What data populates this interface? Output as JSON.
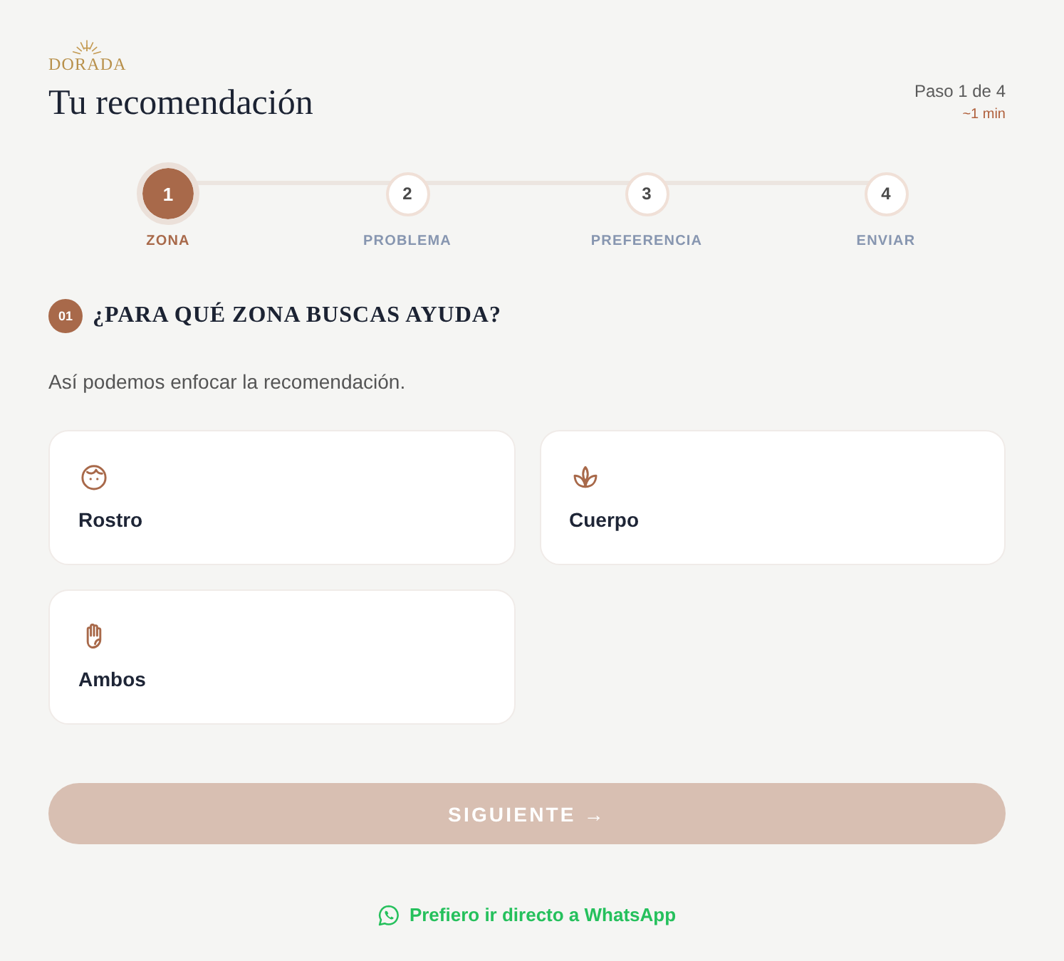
{
  "header": {
    "brand": "DORADA",
    "title": "Tu recomendación",
    "step_counter": "Paso 1 de 4",
    "time_estimate": "~1 min"
  },
  "steps": [
    {
      "number": "1",
      "label": "ZONA",
      "selected": true
    },
    {
      "number": "2",
      "label": "PROBLEMA",
      "selected": false
    },
    {
      "number": "3",
      "label": "PREFERENCIA",
      "selected": false
    },
    {
      "number": "4",
      "label": "ENVIAR",
      "selected": false
    }
  ],
  "question": {
    "number": "01",
    "title": "¿PARA QUÉ ZONA BUSCAS AYUDA?",
    "subtitle": "Así podemos enfocar la recomendación."
  },
  "options": [
    {
      "kind": "face",
      "label": "Rostro",
      "selected": false
    },
    {
      "kind": "body",
      "label": "Cuerpo",
      "selected": false
    },
    {
      "kind": "both",
      "label": "Ambos",
      "selected": false
    }
  ],
  "next_button": {
    "label": "SIGUIENTE →",
    "disabled": true
  },
  "whatsapp_link": {
    "label": "Prefiero ir directo a WhatsApp"
  }
}
